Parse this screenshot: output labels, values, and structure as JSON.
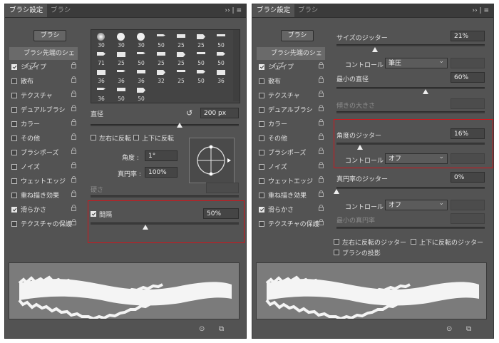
{
  "left": {
    "tabs": [
      "ブラシ設定",
      "ブラシ"
    ],
    "brush_button": "ブラシ",
    "sidebar": [
      {
        "label": "ブラシ先端のシェイプ",
        "checked": null,
        "lock": false
      },
      {
        "label": "シェイプ",
        "checked": true,
        "lock": true
      },
      {
        "label": "散布",
        "checked": false,
        "lock": true
      },
      {
        "label": "テクスチャ",
        "checked": false,
        "lock": true
      },
      {
        "label": "デュアルブラシ",
        "checked": false,
        "lock": true
      },
      {
        "label": "カラー",
        "checked": false,
        "lock": true
      },
      {
        "label": "その他",
        "checked": false,
        "lock": true
      },
      {
        "label": "ブラシポーズ",
        "checked": false,
        "lock": true
      },
      {
        "label": "ノイズ",
        "checked": false,
        "lock": true
      },
      {
        "label": "ウェットエッジ",
        "checked": false,
        "lock": true
      },
      {
        "label": "重ね描き効果",
        "checked": false,
        "lock": true
      },
      {
        "label": "滑らかさ",
        "checked": true,
        "lock": true
      },
      {
        "label": "テクスチャの保護",
        "checked": false,
        "lock": true
      }
    ],
    "tips": [
      "30",
      "30",
      "30",
      "50",
      "25",
      "25",
      "50",
      "71",
      "25",
      "50",
      "25",
      "25",
      "50",
      "50",
      "36",
      "36",
      "36",
      "32",
      "25",
      "50",
      "36",
      "36",
      "50",
      "50"
    ],
    "diameter_label": "直径",
    "diameter_value": "200 px",
    "flip_x": "左右に反転",
    "flip_y": "上下に反転",
    "angle_label": "角度 :",
    "angle_value": "1°",
    "roundness_label": "真円率 :",
    "roundness_value": "100%",
    "hardness_label": "硬さ",
    "spacing_label": "間隔",
    "spacing_value": "50%",
    "spacing_checked": true,
    "spacing_level": 0.37,
    "diameter_level": 0.6
  },
  "right": {
    "tabs": [
      "ブラシ設定",
      "ブラシ"
    ],
    "brush_button": "ブラシ",
    "sidebar": [
      {
        "label": "ブラシ先端のシェイプ",
        "checked": null,
        "lock": false
      },
      {
        "label": "シェイプ",
        "checked": true,
        "lock": true
      },
      {
        "label": "散布",
        "checked": false,
        "lock": true
      },
      {
        "label": "テクスチャ",
        "checked": false,
        "lock": true
      },
      {
        "label": "デュアルブラシ",
        "checked": false,
        "lock": true
      },
      {
        "label": "カラー",
        "checked": false,
        "lock": true
      },
      {
        "label": "その他",
        "checked": false,
        "lock": true
      },
      {
        "label": "ブラシポーズ",
        "checked": false,
        "lock": true
      },
      {
        "label": "ノイズ",
        "checked": false,
        "lock": true
      },
      {
        "label": "ウェットエッジ",
        "checked": false,
        "lock": true
      },
      {
        "label": "重ね描き効果",
        "checked": false,
        "lock": true
      },
      {
        "label": "滑らかさ",
        "checked": true,
        "lock": true
      },
      {
        "label": "テクスチャの保護",
        "checked": false,
        "lock": true
      }
    ],
    "size_jitter_label": "サイズのジッター",
    "size_jitter_value": "21%",
    "control_label": "コントロール :",
    "control1_value": "筆圧",
    "min_diameter_label": "最小の直径",
    "min_diameter_value": "60%",
    "tilt_scale_label": "傾きの大きさ",
    "angle_jitter_label": "角度のジッター",
    "angle_jitter_value": "16%",
    "control2_value": "オフ",
    "roundness_jitter_label": "真円率のジッター",
    "roundness_jitter_value": "0%",
    "control3_value": "オフ",
    "min_roundness_label": "最小の真円率",
    "flip_x_jitter": "左右に反転のジッター",
    "flip_y_jitter": "上下に反転のジッター",
    "brush_projection": "ブラシの投影",
    "size_level": 0.21,
    "min_diameter_level": 0.6,
    "angle_level": 0.16,
    "roundness_level": 0.0
  },
  "colors": {
    "highlight": "#d0161c"
  }
}
